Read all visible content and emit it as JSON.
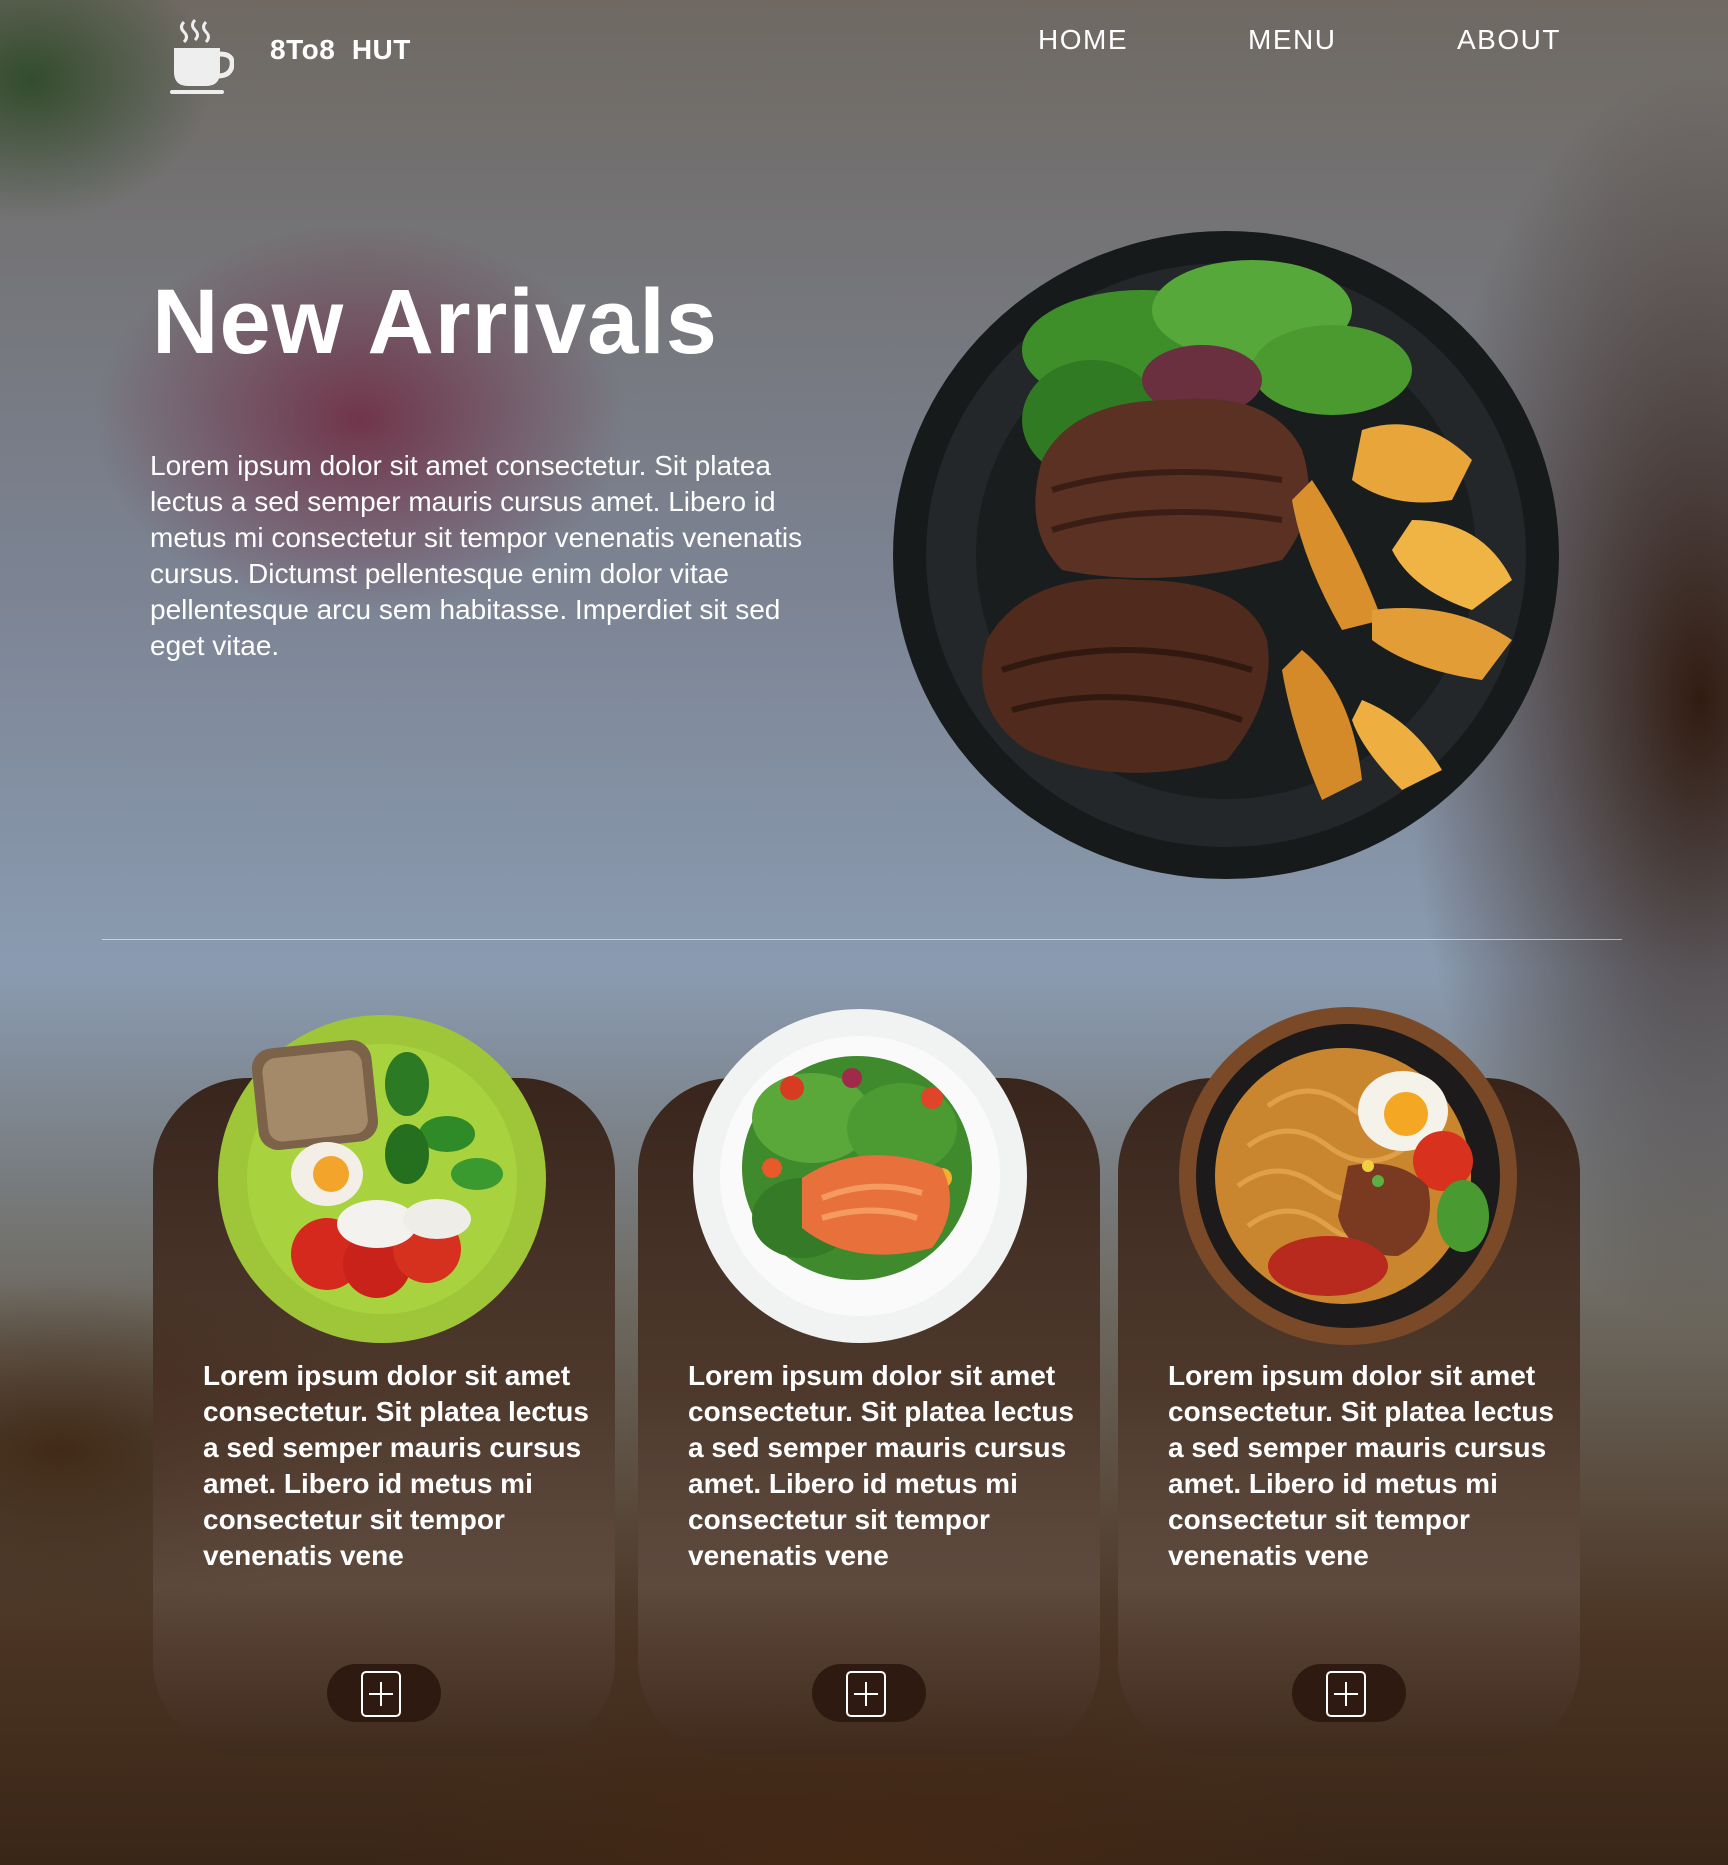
{
  "nav": {
    "brand": "8To8  HUT",
    "logo_icon": "coffee-cup-icon",
    "links": [
      "HOME",
      "MENU",
      "ABOUT"
    ]
  },
  "hero": {
    "title": "New Arrivals",
    "text": "Lorem ipsum dolor sit amet consectetur. Sit platea lectus a sed semper mauris cursus amet. Libero id metus mi consectetur sit tempor venenatis venenatis cursus. Dictumst pellentesque enim dolor vitae pellentesque arcu sem habitasse. Imperdiet sit sed eget vitae.",
    "image": "steak-plate"
  },
  "cards": [
    {
      "image": "breakfast-plate",
      "text": "Lorem ipsum dolor sit amet consectetur. Sit platea lectus a sed semper mauris cursus amet. Libero id metus mi consectetur sit tempor venenatis vene",
      "button_icon": "plus-square-icon"
    },
    {
      "image": "salmon-salad-plate",
      "text": "Lorem ipsum dolor sit amet consectetur. Sit platea lectus a sed semper mauris cursus amet. Libero id metus mi consectetur sit tempor venenatis vene",
      "button_icon": "plus-square-icon"
    },
    {
      "image": "noodle-plate",
      "text": "Lorem ipsum dolor sit amet consectetur. Sit platea lectus a sed semper mauris cursus amet. Libero id metus mi consectetur sit tempor venenatis vene",
      "button_icon": "plus-square-icon"
    }
  ],
  "colors": {
    "text": "#ffffff",
    "button_bg": "#2e1a10",
    "card_top": "#321c10"
  }
}
